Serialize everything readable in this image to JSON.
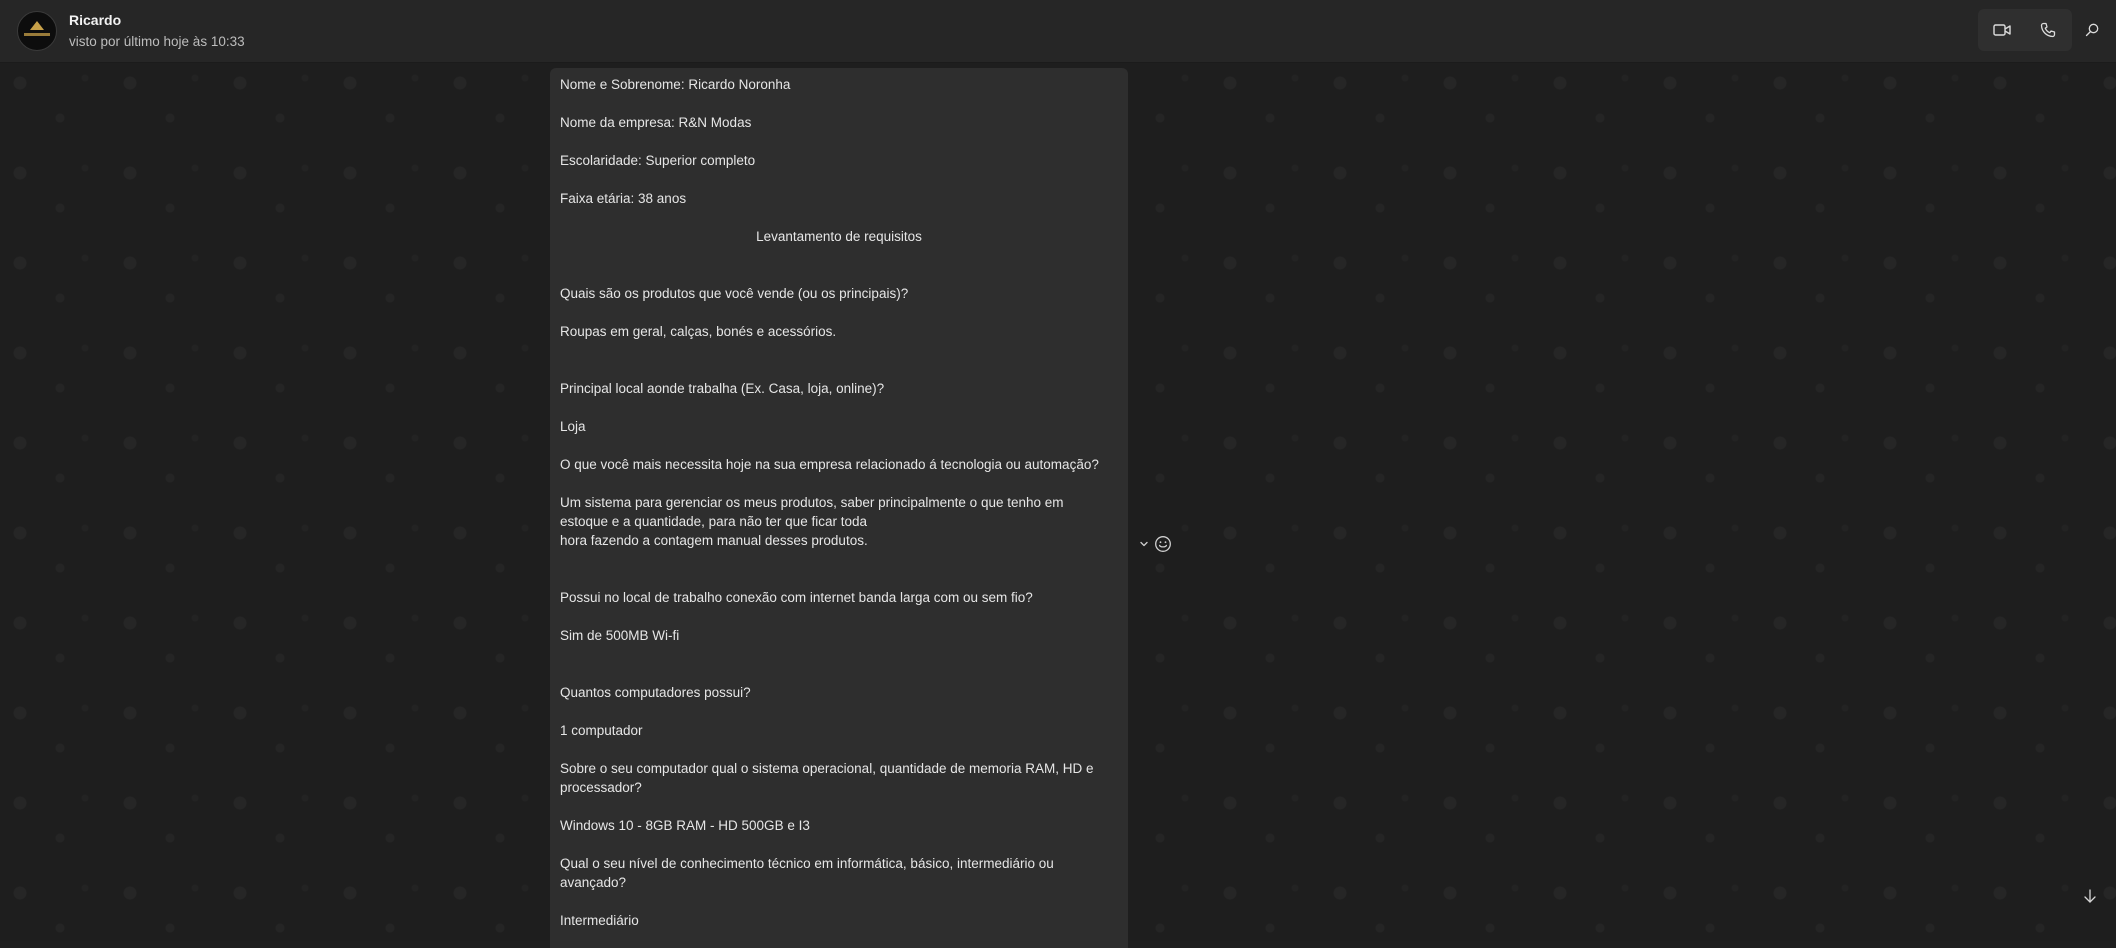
{
  "contact": {
    "name": "Ricardo",
    "status": "visto por último hoje às 10:33"
  },
  "icons": {
    "video": "video-call-icon",
    "phone": "voice-call-icon",
    "search": "search-icon",
    "chevron": "chevron-down-icon",
    "emoji": "emoji-reaction-icon",
    "arrow": "arrow-down-icon"
  },
  "message": {
    "lines": [
      "Nome e Sobrenome:  Ricardo Noronha",
      "Nome da empresa: R&N Modas",
      "Escolaridade: Superior completo",
      "Faixa etária: 38 anos",
      "Levantamento de requisitos",
      "Quais são os produtos que você vende (ou os principais)?",
      "Roupas em geral, calças, bonés e acessórios.",
      "Principal local aonde trabalha (Ex. Casa, loja, online)?",
      "Loja",
      "O que você mais necessita hoje na sua empresa relacionado á tecnologia ou automação?",
      "Um sistema para gerenciar os meus produtos, saber principalmente o que tenho em",
      "estoque e a quantidade, para não ter que ficar toda",
      "hora fazendo a contagem manual desses produtos.",
      "Possui no local de trabalho conexão com internet banda larga com ou sem fio?",
      "Sim de 500MB Wi-fi",
      "Quantos computadores possui?",
      "1 computador",
      "Sobre o seu computador qual o sistema operacional, quantidade de memoria RAM, HD e",
      "processador?",
      "Windows 10 - 8GB RAM - HD 500GB e I3",
      "Qual o seu nível de conhecimento técnico em informática, básico, intermediário ou",
      "avançado?",
      "Intermediário"
    ]
  }
}
